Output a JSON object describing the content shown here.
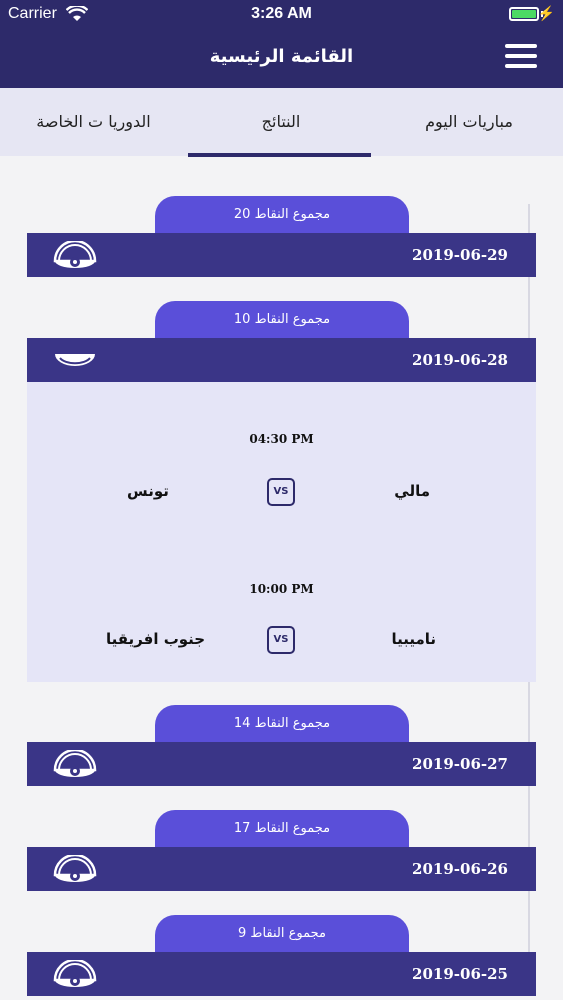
{
  "status_bar": {
    "carrier": "Carrier",
    "time": "3:26 AM",
    "charging_glyph": "⚡"
  },
  "header": {
    "title": "القائمة الرئيسية",
    "menu_icon": "hamburger-menu-icon"
  },
  "tabs": [
    {
      "label": "مباريات اليوم",
      "active": false
    },
    {
      "label": "النتائج",
      "active": true
    },
    {
      "label": "الدوريا ت الخاصة",
      "active": false
    }
  ],
  "colors": {
    "header_bg": "#2d2a6a",
    "pill_bg": "#5a4fd9",
    "date_bar_bg": "#3a3587",
    "expanded_bg": "#e5e5f7",
    "battery": "#4cd964"
  },
  "rounds": [
    {
      "points_label": "مجموع النقاط 20",
      "date": "2019-06-29",
      "expanded": false
    },
    {
      "points_label": "مجموع النقاط 10",
      "date": "2019-06-28",
      "expanded": true,
      "matches": [
        {
          "time": "04:30 PM",
          "home": "مالي",
          "away": "تونس",
          "vs": "VS"
        },
        {
          "time": "10:00 PM",
          "home": "ناميبيا",
          "away": "جنوب افريقيا",
          "vs": "VS"
        }
      ]
    },
    {
      "points_label": "مجموع النقاط 14",
      "date": "2019-06-27",
      "expanded": false
    },
    {
      "points_label": "مجموع النقاط 17",
      "date": "2019-06-26",
      "expanded": false
    },
    {
      "points_label": "مجموع النقاط 9",
      "date": "2019-06-25",
      "expanded": false
    }
  ]
}
